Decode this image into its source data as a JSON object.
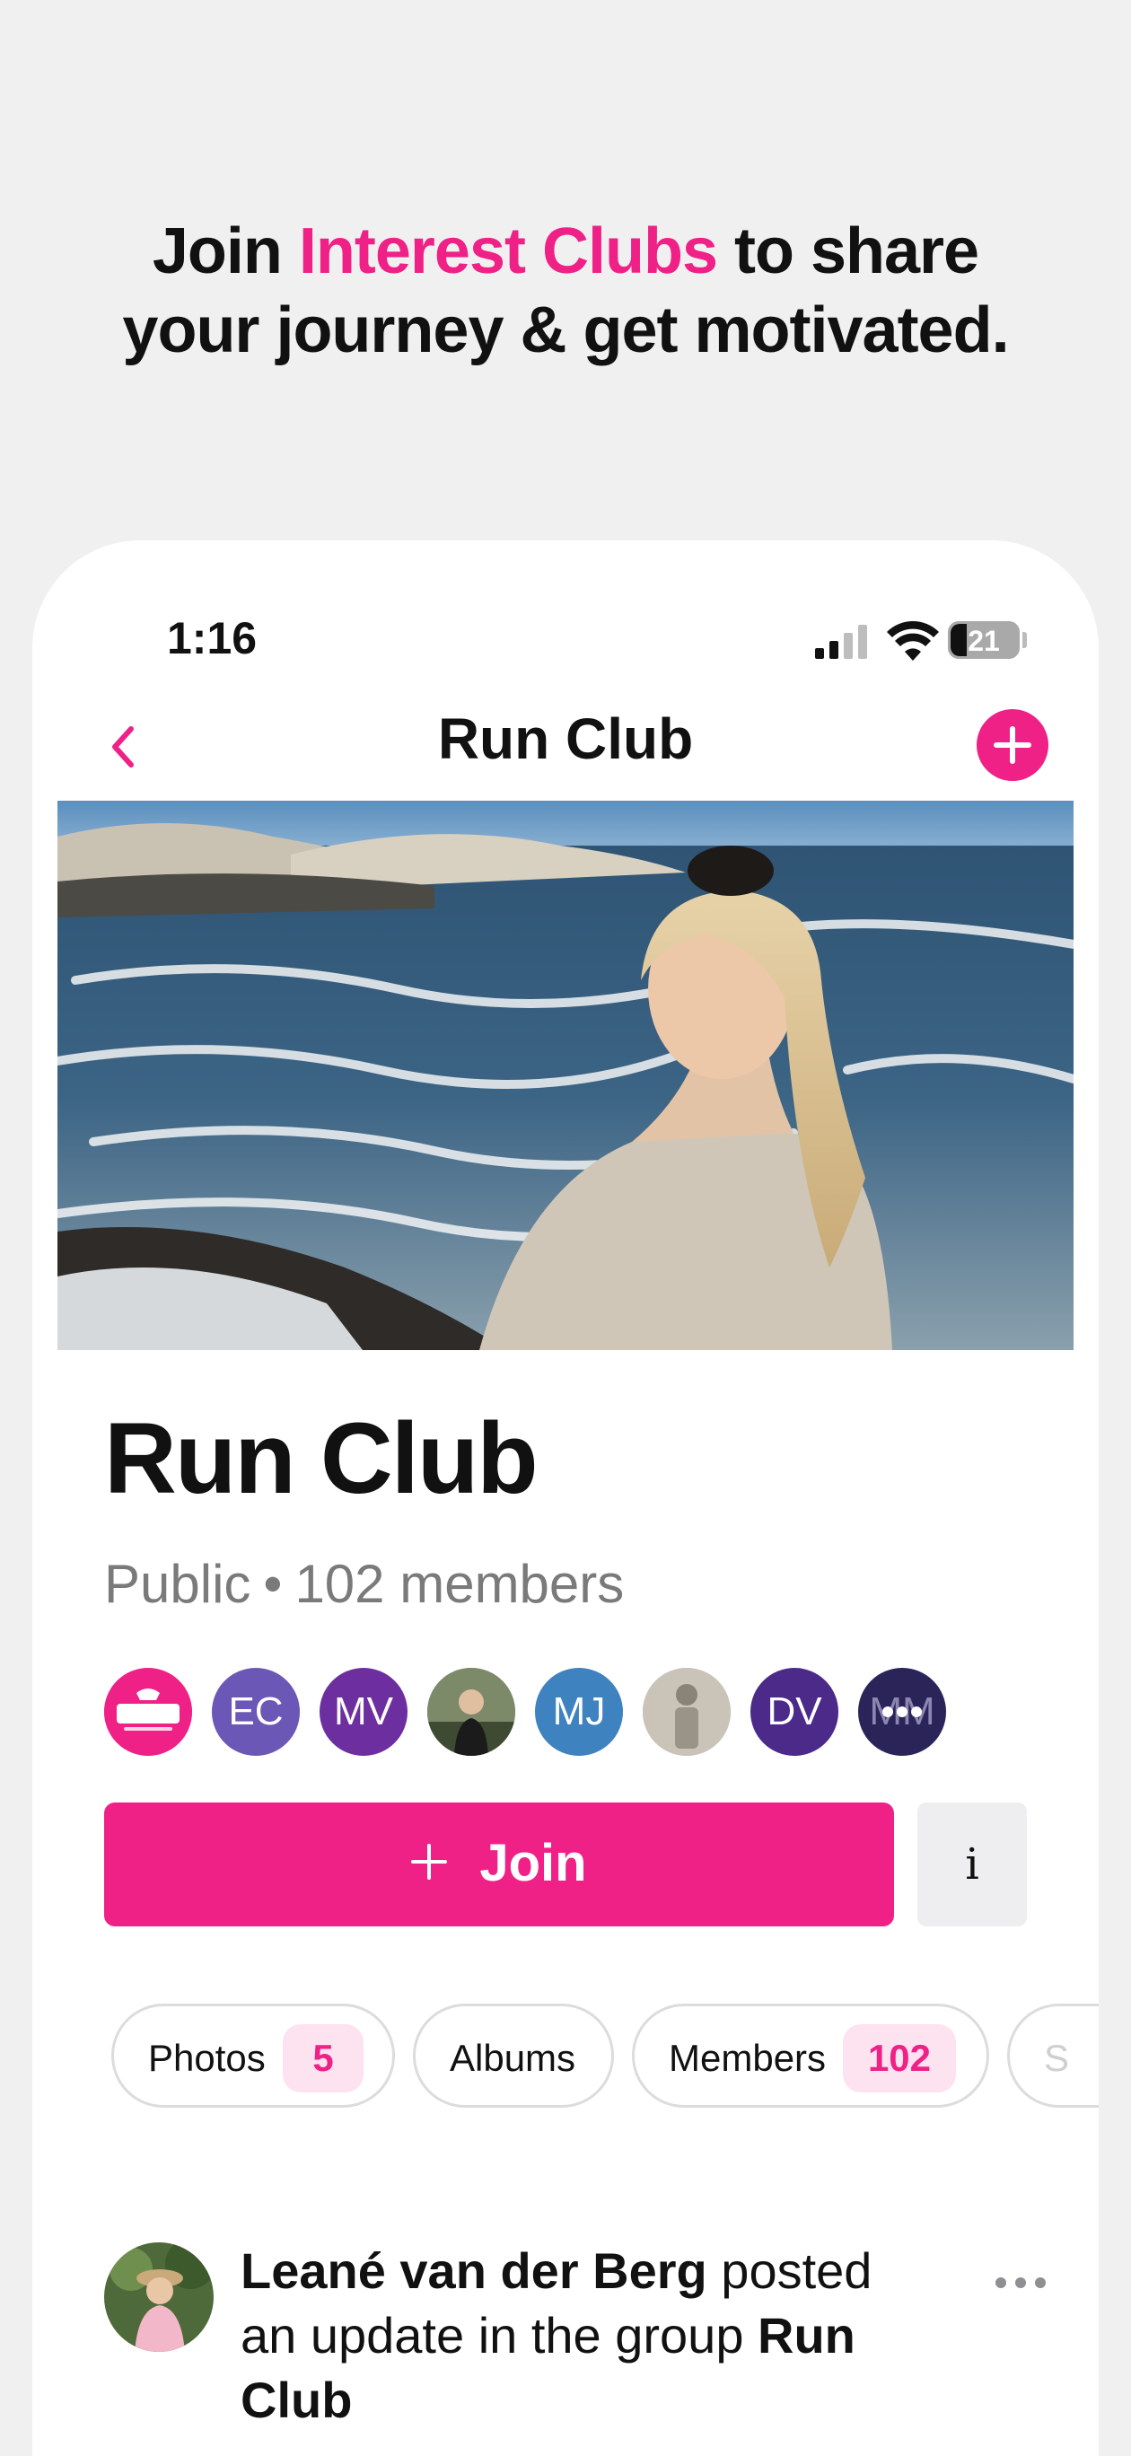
{
  "headline": {
    "part1": "Join ",
    "accent": "Interest Clubs",
    "part2": " to share",
    "line2": "your journey & get motivated."
  },
  "status_bar": {
    "time": "1:16",
    "battery": "21"
  },
  "nav": {
    "title": "Run Club",
    "back_icon": "chevron-left-icon",
    "add_icon": "plus-icon"
  },
  "club": {
    "name": "Run Club",
    "visibility": "Public",
    "separator": "•",
    "members_label": "102 members"
  },
  "member_avatars": [
    {
      "initials": "gutsy",
      "color": "#ef2187",
      "kind": "logo"
    },
    {
      "initials": "EC",
      "color": "#6b57b5",
      "kind": "initials"
    },
    {
      "initials": "MV",
      "color": "#6d2fa0",
      "kind": "initials"
    },
    {
      "initials": "",
      "color": "#5b6b4a",
      "kind": "photo"
    },
    {
      "initials": "MJ",
      "color": "#3f82c0",
      "kind": "initials"
    },
    {
      "initials": "",
      "color": "#b8b2a8",
      "kind": "photo"
    },
    {
      "initials": "DV",
      "color": "#4b2a8a",
      "kind": "initials"
    },
    {
      "initials": "MM",
      "color": "#2a2458",
      "kind": "more"
    }
  ],
  "actions": {
    "join_label": "Join",
    "info_label": "i"
  },
  "tabs": [
    {
      "label": "Photos",
      "count": "5"
    },
    {
      "label": "Albums",
      "count": ""
    },
    {
      "label": "Members",
      "count": "102"
    },
    {
      "label": "S",
      "count": ""
    }
  ],
  "post": {
    "author": "Leané van der Berg",
    "action": " posted an update in the group ",
    "group": "Run Club"
  },
  "colors": {
    "accent": "#ef2187",
    "badge_bg": "#fde2ef",
    "background": "#f0f0f0"
  }
}
